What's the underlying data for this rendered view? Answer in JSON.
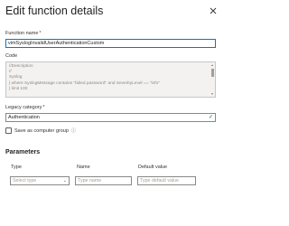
{
  "panel": {
    "title": "Edit function details"
  },
  "function_name": {
    "label": "Function name",
    "required": "*",
    "value": "vimSyslogInvalidUserAuthenticationCustom"
  },
  "code": {
    "label": "Code",
    "lines": [
      "//Description",
      "//",
      "Syslog",
      "| where SyslogMessage contains \"failed password\" and SeverityLevel == \"info\"",
      "| limit 100"
    ]
  },
  "legacy_category": {
    "label": "Legacy category",
    "required": "*",
    "value": "Authentication"
  },
  "computer_group": {
    "label": "Save as computer group",
    "checked": false
  },
  "parameters": {
    "title": "Parameters",
    "headers": {
      "type": "Type",
      "name": "Name",
      "default": "Default value"
    },
    "row": {
      "type_placeholder": "Select type",
      "name_placeholder": "Type name",
      "default_placeholder": "Type default value"
    }
  },
  "colors": {
    "accent": "#0078d4",
    "required": "#a4262c",
    "success": "#107c10"
  }
}
